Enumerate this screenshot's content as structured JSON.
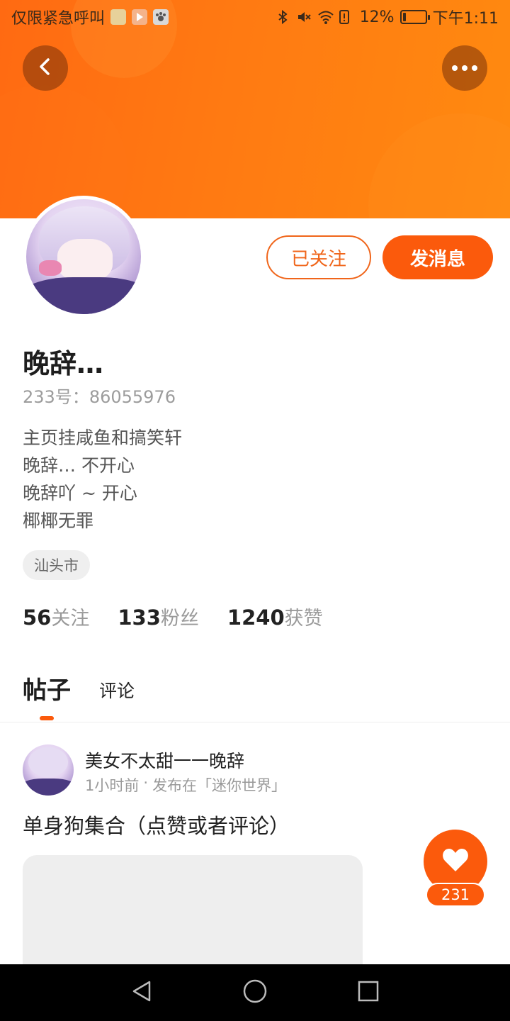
{
  "status_bar": {
    "carrier": "仅限紧急呼叫",
    "battery_percent": "12%",
    "battery_level": 0.12,
    "time": "下午1:11",
    "icons": [
      "app-icon",
      "play-icon",
      "paw-icon",
      "bluetooth-icon",
      "mute-icon",
      "wifi-icon",
      "alert-icon",
      "battery-icon"
    ]
  },
  "header": {
    "back_icon": "chevron-left-icon",
    "more_icon": "more-dots-icon"
  },
  "profile": {
    "username": "晚辞…",
    "id_label": "233号：",
    "id_value": "86055976",
    "bio": [
      "主页挂咸鱼和搞笑轩",
      "晚辞… 不开心",
      "晚辞吖 ~ 开心",
      "椰椰无罪"
    ],
    "location": "汕头市",
    "follow_button": "已关注",
    "message_button": "发消息",
    "stats": [
      {
        "value": "56",
        "label": "关注"
      },
      {
        "value": "133",
        "label": "粉丝"
      },
      {
        "value": "1240",
        "label": "获赞"
      }
    ]
  },
  "tabs": [
    {
      "label": "帖子",
      "active": true
    },
    {
      "label": "评论",
      "active": false
    }
  ],
  "post": {
    "author": "美女不太甜一一晚辞",
    "time": "1小时前",
    "separator": "·",
    "location": "发布在「迷你世界」",
    "title": "单身狗集合（点赞或者评论）",
    "like_count": "231"
  },
  "colors": {
    "accent": "#fb5a0c",
    "banner": "#ff7a12"
  },
  "nav_bar": {
    "icons": [
      "back-triangle-icon",
      "home-circle-icon",
      "recents-square-icon"
    ]
  }
}
